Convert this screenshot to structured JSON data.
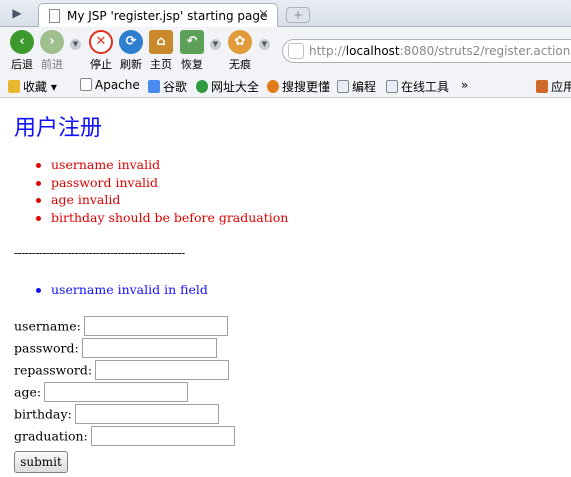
{
  "browser": {
    "tab_title": "My JSP 'register.jsp' starting page",
    "tab_close": "×",
    "newtab": "+",
    "url_prefix": "http://",
    "url_host": "localhost",
    "url_rest": ":8080/struts2/register.action?u",
    "toolbar": {
      "back": "后退",
      "forward": "前进",
      "stop": "停止",
      "refresh": "刷新",
      "home": "主页",
      "restore": "恢复",
      "incognito": "无痕"
    },
    "bookmarks": {
      "favorites": "收藏",
      "apache": "Apache",
      "google": "谷歌",
      "url_directory": "网址大全",
      "sogou": "搜搜更懂",
      "programming": "编程",
      "online_tools": "在线工具",
      "more": "»",
      "apps": "应用"
    }
  },
  "page": {
    "title": "用户注册",
    "action_errors": [
      "username invalid",
      "password invalid",
      "age invalid",
      "birthday should be before graduation"
    ],
    "separator": "------------------------------------------------",
    "field_errors": [
      "username invalid in field"
    ],
    "form": {
      "username_label": "username:",
      "username_value": "",
      "password_label": "password:",
      "password_value": "",
      "repassword_label": "repassword:",
      "repassword_value": "",
      "age_label": "age:",
      "age_value": "",
      "birthday_label": "birthday:",
      "birthday_value": "",
      "graduation_label": "graduation:",
      "graduation_value": "",
      "submit_label": "submit"
    }
  },
  "colors": {
    "title": "#1010ff",
    "error": "#e00000",
    "field_error": "#1010ff"
  }
}
